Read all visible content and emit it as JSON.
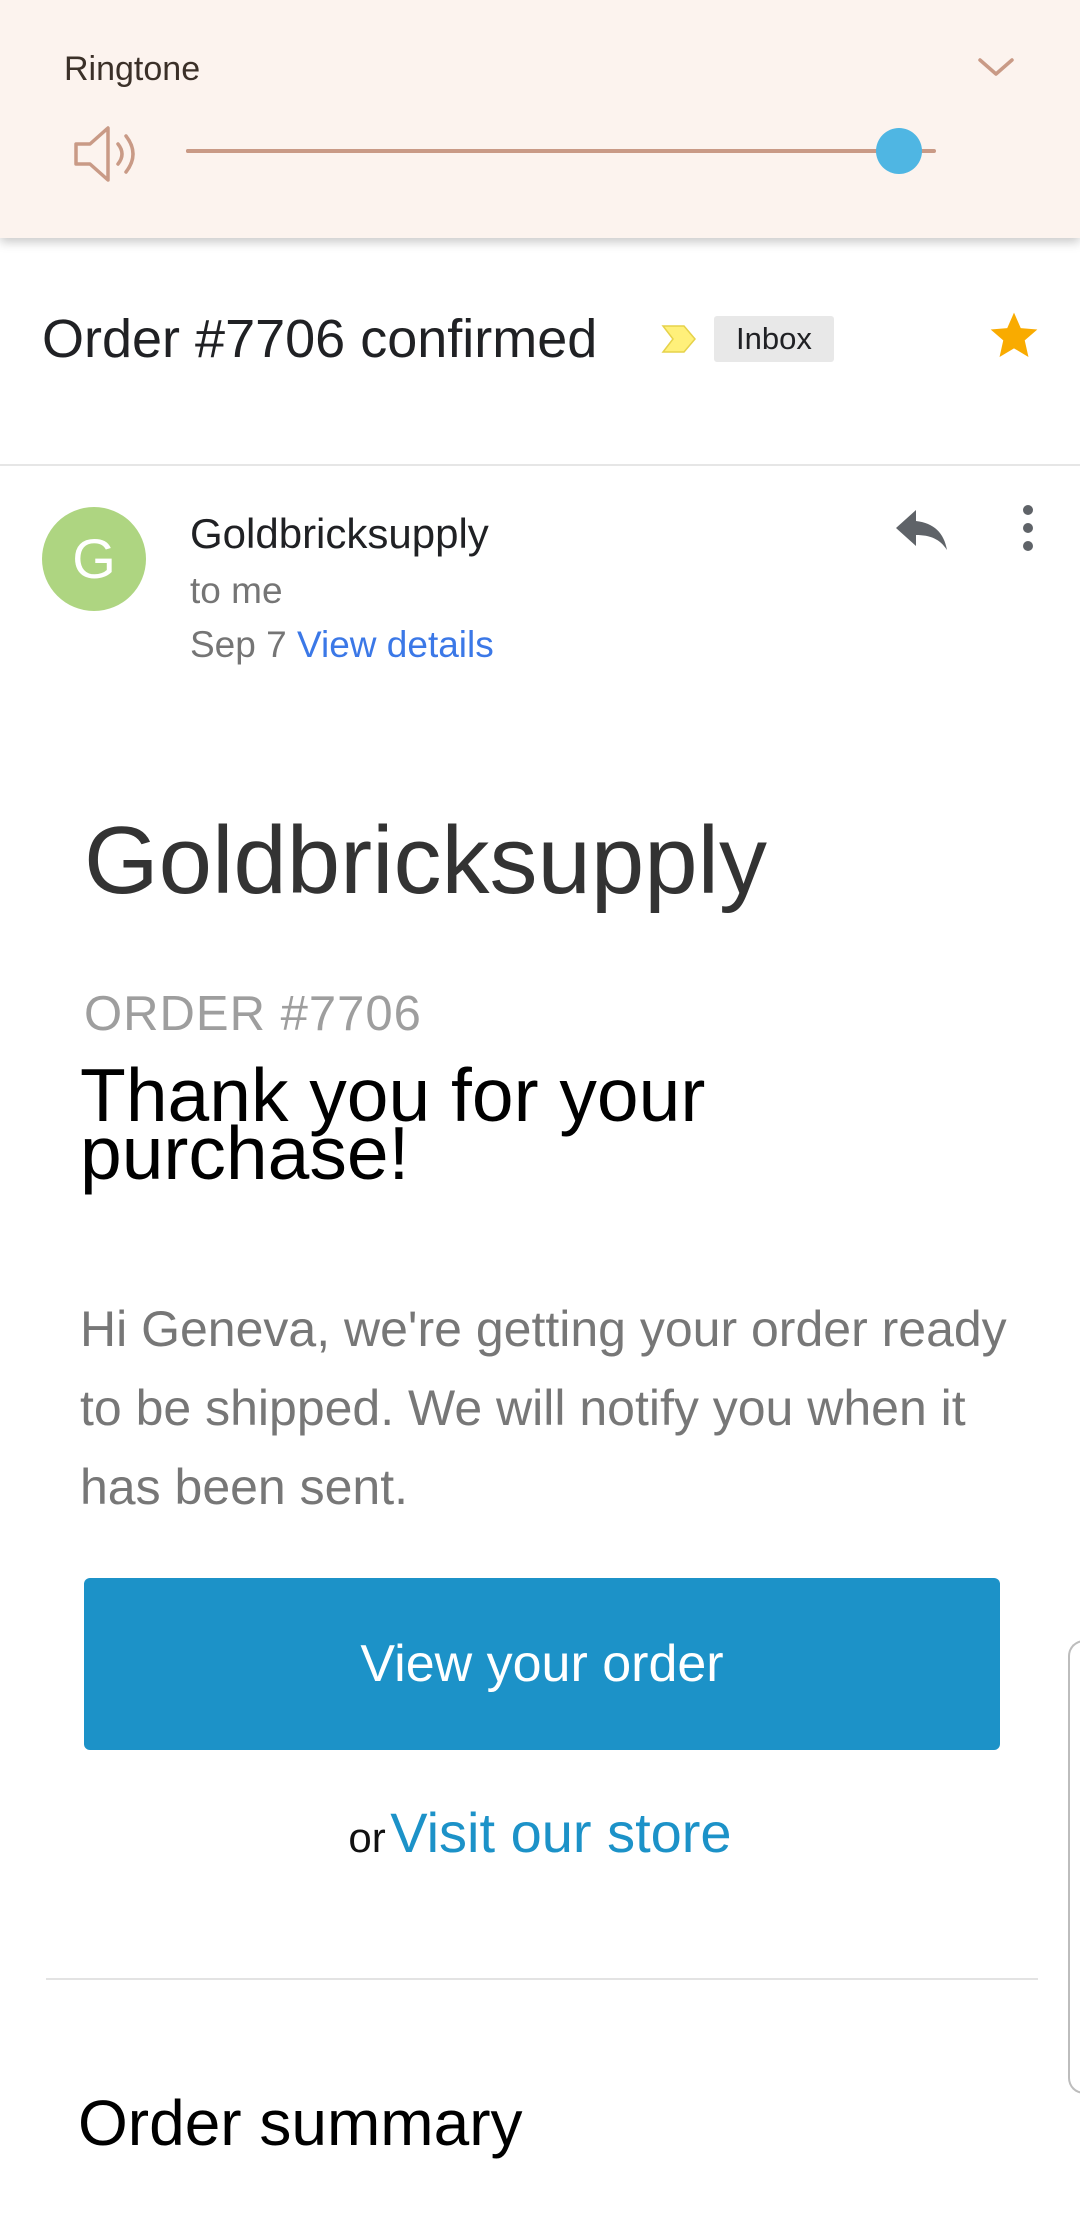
{
  "volume_panel": {
    "label": "Ringtone",
    "level": 0.95,
    "icons": {
      "speaker": "speaker-icon",
      "collapse": "chevron-down-icon"
    },
    "colors": {
      "panel": "#fcf3ee",
      "track": "#c99a86",
      "thumb": "#4fb6e3"
    }
  },
  "email": {
    "subject": "Order #7706 confirmed",
    "label_chip": "Inbox",
    "starred": true,
    "sender": {
      "avatar_letter": "G",
      "name": "Goldbricksupply",
      "to": "to me",
      "date": "Sep 7",
      "details_link": "View details"
    },
    "body": {
      "store_name": "Goldbricksupply",
      "order_number": "ORDER #7706",
      "thanks_line1": "Thank you for your",
      "thanks_line2": "purchase!",
      "message": "Hi Geneva, we're getting your order ready to be shipped. We will notify you when it has been sent.",
      "primary_button": "View your order",
      "or_text": "or",
      "store_link": "Visit our store",
      "section_heading": "Order summary"
    },
    "colors": {
      "avatar": "#aed581",
      "link": "#3b78e7",
      "button": "#1c92c8",
      "star": "#f9ab00"
    }
  }
}
